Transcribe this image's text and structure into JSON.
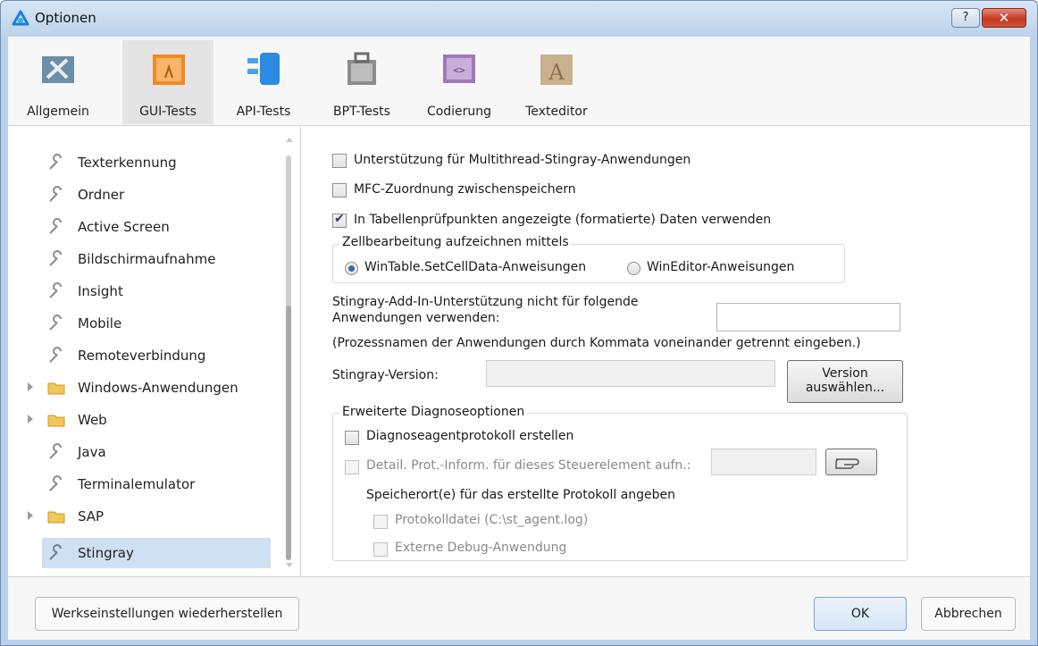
{
  "window": {
    "title": "Optionen",
    "help_label": "?",
    "close_label": "✕"
  },
  "toolbar": {
    "tabs": [
      {
        "label": "Allgemein",
        "icon": "general-tools-icon"
      },
      {
        "label": "GUI-Tests",
        "icon": "gui-tests-icon"
      },
      {
        "label": "API-Tests",
        "icon": "api-tests-icon"
      },
      {
        "label": "BPT-Tests",
        "icon": "bpt-tests-icon"
      },
      {
        "label": "Codierung",
        "icon": "coding-icon"
      },
      {
        "label": "Texteditor",
        "icon": "text-editor-icon"
      }
    ],
    "active_tab": "GUI-Tests"
  },
  "nav": {
    "items": [
      {
        "label": "Texterkennung",
        "icon": "wrench-icon",
        "expandable": false
      },
      {
        "label": "Ordner",
        "icon": "wrench-icon",
        "expandable": false
      },
      {
        "label": "Active Screen",
        "icon": "wrench-icon",
        "expandable": false
      },
      {
        "label": "Bildschirmaufnahme",
        "icon": "wrench-icon",
        "expandable": false
      },
      {
        "label": "Insight",
        "icon": "wrench-icon",
        "expandable": false
      },
      {
        "label": "Mobile",
        "icon": "wrench-icon",
        "expandable": false
      },
      {
        "label": "Remoteverbindung",
        "icon": "wrench-icon",
        "expandable": false
      },
      {
        "label": "Windows-Anwendungen",
        "icon": "folder-icon",
        "expandable": true
      },
      {
        "label": "Web",
        "icon": "folder-icon",
        "expandable": true
      },
      {
        "label": "Java",
        "icon": "wrench-icon",
        "expandable": false
      },
      {
        "label": "Terminalemulator",
        "icon": "wrench-icon",
        "expandable": false
      },
      {
        "label": "SAP",
        "icon": "folder-icon",
        "expandable": true
      },
      {
        "label": "Stingray",
        "icon": "wrench-icon",
        "expandable": false,
        "selected": true
      }
    ]
  },
  "content": {
    "multithread_label": "Unterstützung für Multithread-Stingray-Anwendungen",
    "multithread_checked": false,
    "mfc_label": "MFC-Zuordnung zwischenspeichern",
    "mfc_checked": false,
    "formatted_label": "In Tabellenprüfpunkten angezeigte (formatierte) Daten verwenden",
    "formatted_checked": true,
    "cell_edit_group_title": "Zellbearbeitung aufzeichnen mittels",
    "radio_wintable_label": "WinTable.SetCellData-Anweisungen",
    "radio_wineditor_label": "WinEditor-Anweisungen",
    "radio_selected": "wintable",
    "exclude_label_line1": "Stingray-Add-In-Unterstützung nicht für folgende",
    "exclude_label_line2": "Anwendungen verwenden:",
    "exclude_value": "",
    "exclude_hint": "(Prozessnamen der Anwendungen durch Kommata voneinander getrennt eingeben.)",
    "version_label": "Stingray-Version:",
    "version_value": "",
    "version_button_line1": "Version",
    "version_button_line2": "auswählen...",
    "diag_group_title": "Erweiterte Diagnoseoptionen",
    "diag_agent_label": "Diagnoseagentprotokoll erstellen",
    "diag_agent_checked": false,
    "detail_label": "Detail. Prot.-Inform. für dieses Steuerelement aufn.:",
    "detail_value": "",
    "pointer_icon": "pointing-hand-icon",
    "location_label": "Speicherort(e) für das erstellte Protokoll angeben",
    "logfile_label": "Protokolldatei (C:\\st_agent.log)",
    "debugger_label": "Externe Debug-Anwendung"
  },
  "footer": {
    "restore_label": "Werkseinstellungen wiederherstellen",
    "ok_label": "OK",
    "cancel_label": "Abbrechen"
  },
  "colors": {
    "title_bar": "#bcd2ea",
    "selection": "#cfe0f2",
    "close_button": "#c43b23"
  }
}
